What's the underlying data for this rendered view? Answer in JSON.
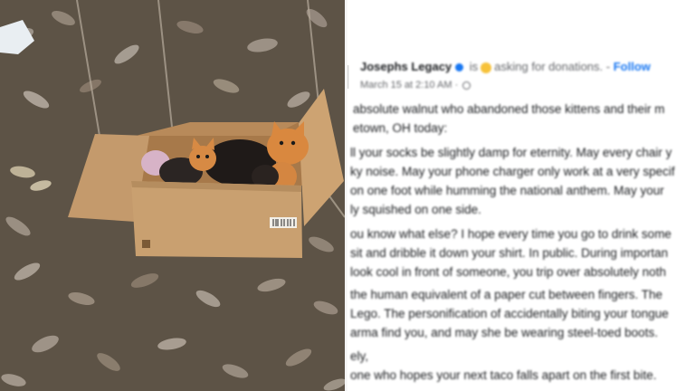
{
  "post": {
    "author": "Josephs Legacy",
    "is_text": "is",
    "asking_text": "asking for donations.",
    "sep": "-",
    "follow": "Follow",
    "timestamp": "March 15 at 2:10 AM",
    "dot": "·",
    "lines": [
      "absolute walnut who abandoned those kittens and their m",
      "etown, OH today:",
      "ll your socks be slightly damp for eternity. May every chair y",
      "ky noise. May your phone charger only work at a very specif",
      "on one foot while humming the national anthem. May your",
      "ly squished on one side.",
      "ou know what else? I hope every time you go to drink some",
      "sit and dribble it down your shirt. In public. During importan",
      "look cool in front of someone, you trip over absolutely noth",
      "the human equivalent of a paper cut between fingers. The",
      "Lego. The personification of accidentally biting your tongue",
      "arma find you, and may she be wearing steel-toed boots.",
      "ely,",
      "one who hopes your next taco falls apart on the first bite."
    ]
  },
  "photo": {
    "subject": "kittens-in-cardboard-box",
    "box_color": "#c9a070",
    "ground_color": "#5d5346"
  }
}
